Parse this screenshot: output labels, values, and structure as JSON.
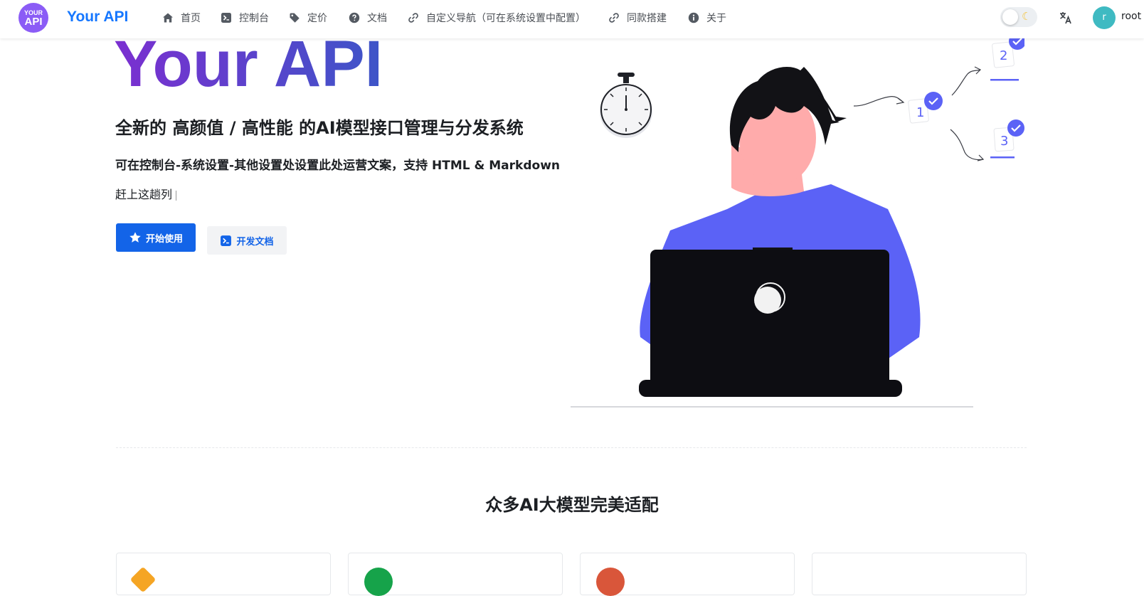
{
  "header": {
    "logo_line1": "YOUR",
    "logo_line2": "API",
    "brand": "Your API",
    "nav": [
      {
        "label": "首页",
        "icon": "home-icon"
      },
      {
        "label": "控制台",
        "icon": "terminal-icon"
      },
      {
        "label": "定价",
        "icon": "tag-icon"
      },
      {
        "label": "文档",
        "icon": "help-circle-icon"
      },
      {
        "label": "自定义导航（可在系统设置中配置）",
        "icon": "link-icon"
      },
      {
        "label": "同款搭建",
        "icon": "link-icon"
      },
      {
        "label": "关于",
        "icon": "info-icon"
      }
    ],
    "theme_toggle_icon": "moon-icon",
    "language_icon": "translate-icon",
    "avatar_letter": "r",
    "username": "root"
  },
  "hero": {
    "title": "Your API",
    "subtitle": "全新的 高颜值 / 高性能 的AI模型接口管理与分发系统",
    "description": "可在控制台-系统设置-其他设置处设置此处运营文案，支持 HTML & Markdown",
    "typing_text": "赶上这趟列",
    "primary_button": "开始使用",
    "secondary_button": "开发文档"
  },
  "illustration": {
    "labels": [
      "1",
      "2",
      "3"
    ]
  },
  "models_section": {
    "title": "众多AI大模型完美适配",
    "card_colors": [
      "#f5a524",
      "#16a34a",
      "#d9563a",
      "#ffffff"
    ]
  },
  "colors": {
    "accent": "#1364e8",
    "brand": "#1677ff",
    "title_gradient_start": "#7b2fd0",
    "title_gradient_end": "#3d55c8",
    "illustration_accent": "#5b62f6"
  }
}
